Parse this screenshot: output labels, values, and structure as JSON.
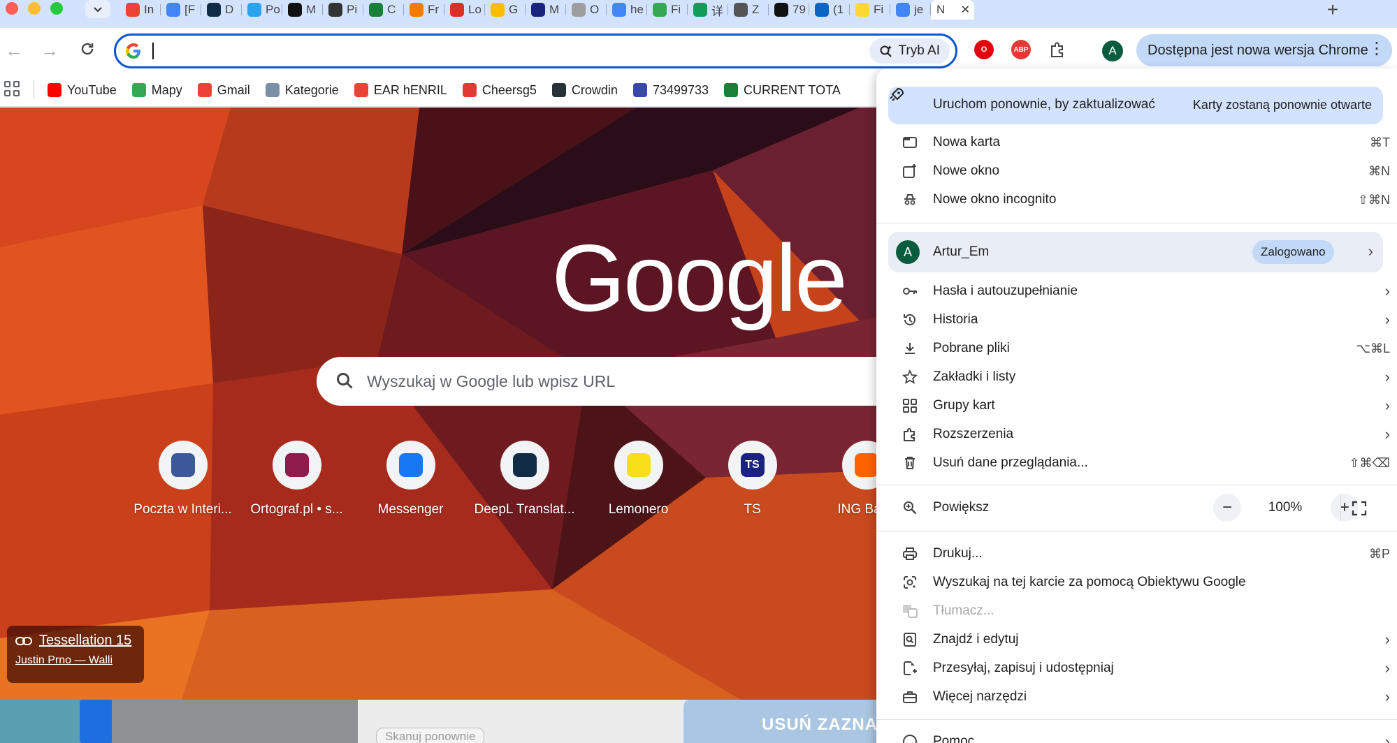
{
  "window": {
    "tabs": [
      {
        "title": "In",
        "favicon": "gmail-icon",
        "color": "#ea4335"
      },
      {
        "title": "[F",
        "favicon": "google-docs-icon",
        "color": "#4285f4"
      },
      {
        "title": "D",
        "favicon": "deepl-icon",
        "color": "#0f2b46"
      },
      {
        "title": "Po",
        "favicon": "paper-plane-icon",
        "color": "#2aa3ef"
      },
      {
        "title": "M",
        "favicon": "upwork-icon",
        "color": "#111111"
      },
      {
        "title": "Pi",
        "favicon": "openai-icon",
        "color": "#333333"
      },
      {
        "title": "C",
        "favicon": "sheet-icon",
        "color": "#188038"
      },
      {
        "title": "Fr",
        "favicon": "letter-a-icon",
        "color": "#f57c00"
      },
      {
        "title": "Lo",
        "favicon": "sow-icon",
        "color": "#d93025"
      },
      {
        "title": "G",
        "favicon": "google-ads-icon",
        "color": "#fbbc04"
      },
      {
        "title": "M",
        "favicon": "shield-icon",
        "color": "#1a237e"
      },
      {
        "title": "O",
        "favicon": "eagle-emblem-icon",
        "color": "#9e9e9e"
      },
      {
        "title": "he",
        "favicon": "google-icon",
        "color": "#4285f4"
      },
      {
        "title": "Fi",
        "favicon": "colorful-grid-icon",
        "color": "#34a853"
      },
      {
        "title": "详",
        "favicon": "globe-icon",
        "color": "#0f9d58"
      },
      {
        "title": "Z",
        "favicon": "temple-icon",
        "color": "#555555"
      },
      {
        "title": "79",
        "favicon": "checker-icon",
        "color": "#111111"
      },
      {
        "title": "(1",
        "favicon": "linkedin-icon",
        "color": "#0a66c2"
      },
      {
        "title": "Fi",
        "favicon": "lemon-icon",
        "color": "#fdd835"
      },
      {
        "title": "je",
        "favicon": "google-icon",
        "color": "#4285f4"
      },
      {
        "title": "N",
        "favicon": "none",
        "color": "#ffffff",
        "active": true
      }
    ]
  },
  "toolbar": {
    "omnibox_value": "",
    "ai_mode_label": "Tryb AI",
    "update_chip_label": "Dostępna jest nowa wersja Chrome",
    "profile_initial": "A"
  },
  "bookmarks": [
    {
      "label": "YouTube",
      "icon": "youtube-icon",
      "color": "#ff0000"
    },
    {
      "label": "Mapy",
      "icon": "maps-pin-icon",
      "color": "#34a853"
    },
    {
      "label": "Gmail",
      "icon": "gmail-icon",
      "color": "#ea4335"
    },
    {
      "label": "Kategorie",
      "icon": "category-icon",
      "color": "#7b8fa8"
    },
    {
      "label": "EAR hENRIL",
      "icon": "gmail-icon",
      "color": "#ea4335"
    },
    {
      "label": "Cheersg5",
      "icon": "colorful-ball-icon",
      "color": "#e53935"
    },
    {
      "label": "Crowdin",
      "icon": "crowdin-icon",
      "color": "#263238"
    },
    {
      "label": "73499733",
      "icon": "bank-icon",
      "color": "#3949ab"
    },
    {
      "label": "CURRENT TOTA",
      "icon": "sheet-icon",
      "color": "#188038"
    }
  ],
  "ntp": {
    "logo": "Google",
    "search_placeholder": "Wyszukaj w Google lub wpisz URL",
    "shortcuts": [
      {
        "label": "Poczta w Interi...",
        "icon": "mail-icon",
        "color": "#3b5998"
      },
      {
        "label": "Ortograf.pl • s...",
        "icon": "ortograf-icon",
        "color": "#8e1b4c"
      },
      {
        "label": "Messenger",
        "icon": "messenger-icon",
        "color": "#1877f2"
      },
      {
        "label": "DeepL Translat...",
        "icon": "deepl-icon",
        "color": "#0f2b46"
      },
      {
        "label": "Lemonero",
        "icon": "lemon-icon",
        "color": "#f7e01a"
      },
      {
        "label": "TS",
        "icon": "ts-icon",
        "color": "#1a237e",
        "text": "TS"
      },
      {
        "label": "ING Bank",
        "icon": "ing-lion-icon",
        "color": "#ff6200"
      }
    ],
    "attribution": {
      "title": "Tessellation 15",
      "author": "Justin Prno — Walli"
    }
  },
  "background_window": {
    "rescan_label": "Skanuj ponownie",
    "action_label": "USUŃ ZAZNAC"
  },
  "menu": {
    "update": {
      "label": "Uruchom ponownie, by zaktualizować",
      "note": "Karty zostaną ponownie otwarte"
    },
    "group1": [
      {
        "label": "Nowa karta",
        "shortcut": "⌘T",
        "icon": "new-tab-icon"
      },
      {
        "label": "Nowe okno",
        "shortcut": "⌘N",
        "icon": "new-window-icon"
      },
      {
        "label": "Nowe okno incognito",
        "shortcut": "⇧⌘N",
        "icon": "incognito-icon"
      }
    ],
    "profile": {
      "initial": "A",
      "name": "Artur_Em",
      "status": "Zalogowano"
    },
    "group2": [
      {
        "label": "Hasła i autouzupełnianie",
        "icon": "key-icon",
        "submenu": true
      },
      {
        "label": "Historia",
        "icon": "history-icon",
        "submenu": true
      },
      {
        "label": "Pobrane pliki",
        "shortcut": "⌥⌘L",
        "icon": "download-icon"
      },
      {
        "label": "Zakładki i listy",
        "icon": "star-icon",
        "submenu": true
      },
      {
        "label": "Grupy kart",
        "icon": "tab-groups-icon",
        "submenu": true
      },
      {
        "label": "Rozszerzenia",
        "icon": "extension-icon",
        "submenu": true
      },
      {
        "label": "Usuń dane przeglądania...",
        "shortcut": "⇧⌘⌫",
        "icon": "trash-icon"
      }
    ],
    "zoom": {
      "label": "Powiększ",
      "value": "100%",
      "minus": "−",
      "plus": "+"
    },
    "group3": [
      {
        "label": "Drukuj...",
        "shortcut": "⌘P",
        "icon": "print-icon"
      },
      {
        "label": "Wyszukaj na tej karcie za pomocą Obiektywu Google",
        "icon": "lens-icon"
      },
      {
        "label": "Tłumacz...",
        "icon": "translate-icon",
        "disabled": true
      },
      {
        "label": "Znajdź i edytuj",
        "icon": "find-icon",
        "submenu": true
      },
      {
        "label": "Przesyłaj, zapisuj i udostępniaj",
        "icon": "cast-save-icon",
        "submenu": true
      },
      {
        "label": "Więcej narzędzi",
        "icon": "toolbox-icon",
        "submenu": true
      }
    ],
    "help": {
      "label": "Pomoc",
      "icon": "help-icon"
    }
  }
}
